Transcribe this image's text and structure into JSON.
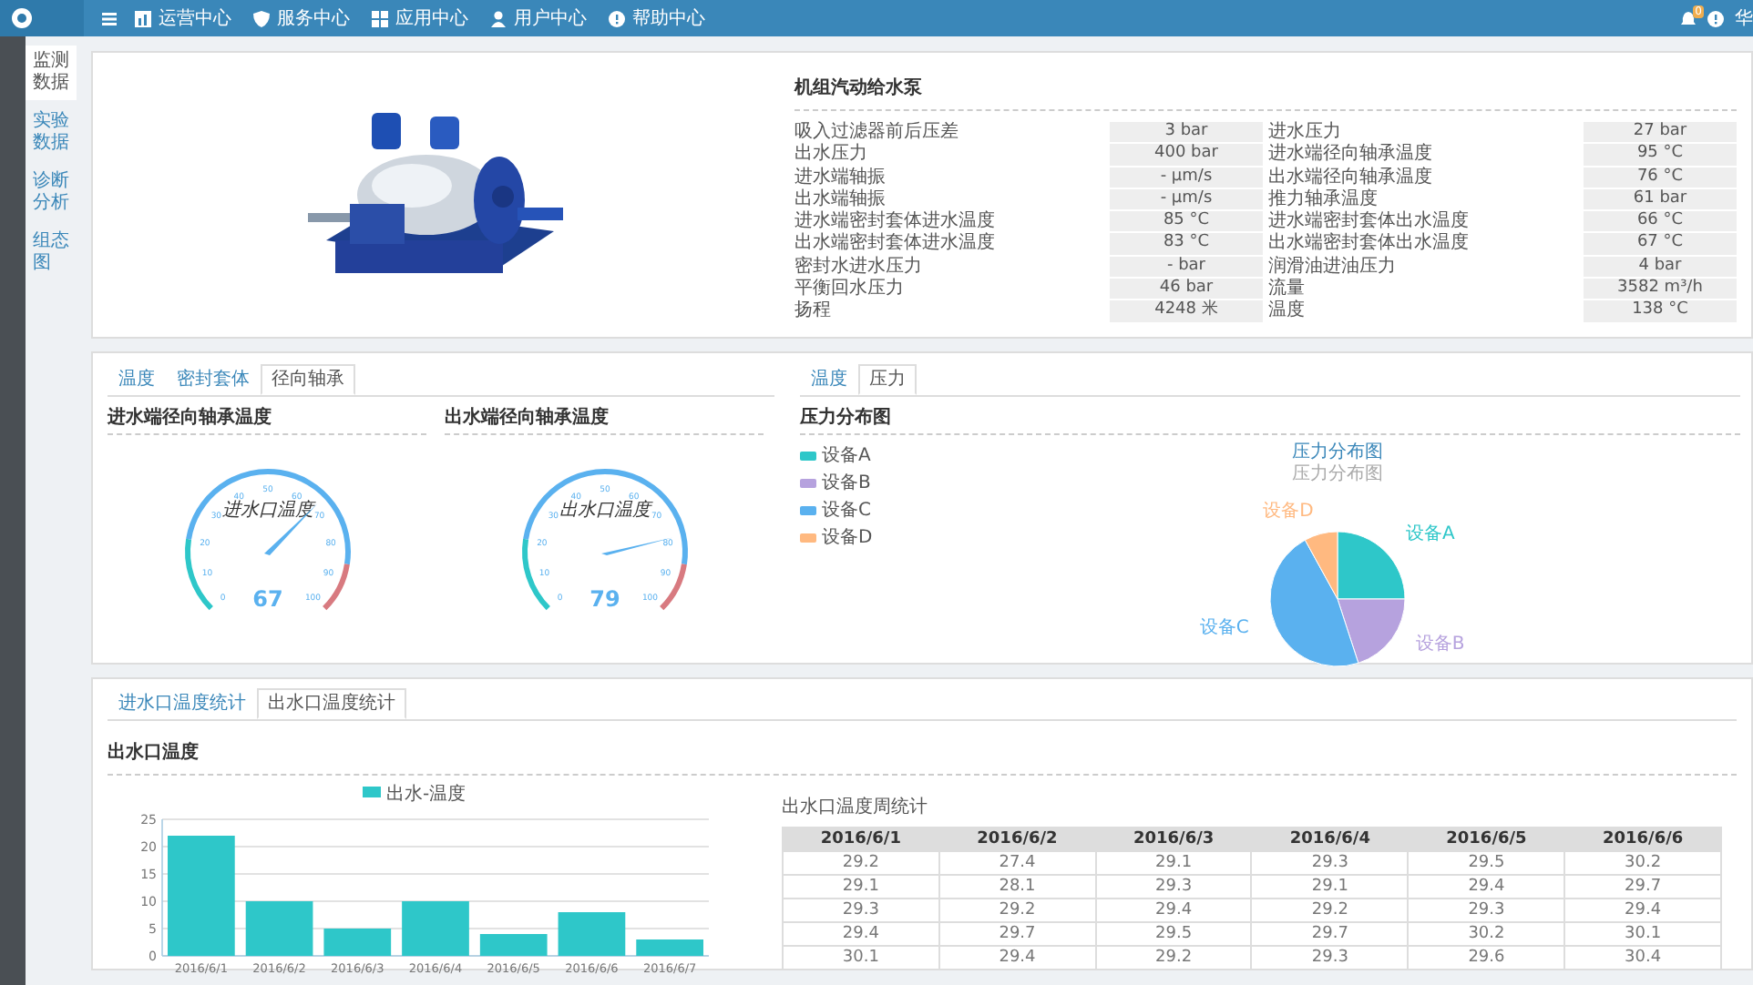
{
  "topbar": {
    "nav": [
      {
        "label": "运营中心"
      },
      {
        "label": "服务中心"
      },
      {
        "label": "应用中心"
      },
      {
        "label": "用户中心"
      },
      {
        "label": "帮助中心"
      }
    ],
    "notification_count": "0",
    "user": "华"
  },
  "sidebar": {
    "items": [
      {
        "label": "监测数据",
        "selected": true
      },
      {
        "label": "实验数据",
        "selected": false
      },
      {
        "label": "诊断分析",
        "selected": false
      },
      {
        "label": "组态图",
        "selected": false
      }
    ]
  },
  "device": {
    "title": "机组汽动给水泵",
    "params": [
      {
        "label": "吸入过滤器前后压差",
        "value": "3 bar"
      },
      {
        "label": "进水压力",
        "value": "27 bar"
      },
      {
        "label": "出水压力",
        "value": "400 bar"
      },
      {
        "label": "进水端径向轴承温度",
        "value": "95 °C"
      },
      {
        "label": "进水端轴振",
        "value": "- μm/s"
      },
      {
        "label": "出水端径向轴承温度",
        "value": "76 °C"
      },
      {
        "label": "出水端轴振",
        "value": "- μm/s"
      },
      {
        "label": "推力轴承温度",
        "value": "61 bar"
      },
      {
        "label": "进水端密封套体进水温度",
        "value": "85 °C"
      },
      {
        "label": "进水端密封套体出水温度",
        "value": "66 °C"
      },
      {
        "label": "出水端密封套体进水温度",
        "value": "83 °C"
      },
      {
        "label": "出水端密封套体出水温度",
        "value": "67 °C"
      },
      {
        "label": "密封水进水压力",
        "value": "- bar"
      },
      {
        "label": "润滑油进油压力",
        "value": "4 bar"
      },
      {
        "label": "平衡回水压力",
        "value": "46 bar"
      },
      {
        "label": "流量",
        "value": "3582 m³/h"
      },
      {
        "label": "扬程",
        "value": "4248 米"
      },
      {
        "label": "温度",
        "value": "138 °C"
      }
    ]
  },
  "bearing_panel": {
    "tabs": [
      {
        "label": "温度",
        "selected": false
      },
      {
        "label": "密封套体",
        "selected": false
      },
      {
        "label": "径向轴承",
        "selected": true
      }
    ],
    "gauges": [
      {
        "title": "进水端径向轴承温度",
        "name": "进水口温度",
        "value": "67",
        "ticks": [
          "0",
          "10",
          "20",
          "30",
          "40",
          "50",
          "60",
          "70",
          "80",
          "90",
          "100"
        ]
      },
      {
        "title": "出水端径向轴承温度",
        "name": "出水口温度",
        "value": "79",
        "ticks": [
          "0",
          "10",
          "20",
          "30",
          "40",
          "50",
          "60",
          "70",
          "80",
          "90",
          "100"
        ]
      }
    ]
  },
  "pressure_panel": {
    "tabs": [
      {
        "label": "温度",
        "selected": false
      },
      {
        "label": "压力",
        "selected": true
      }
    ],
    "heading": "压力分布图",
    "pie_title": "压力分布图",
    "pie_subtitle": "压力分布图",
    "pie_labels": [
      "设备A",
      "设备B",
      "设备C",
      "设备D"
    ],
    "legend": [
      {
        "label": "设备A",
        "color": "#2ec7c9"
      },
      {
        "label": "设备B",
        "color": "#b6a2de"
      },
      {
        "label": "设备C",
        "color": "#5ab1ef"
      },
      {
        "label": "设备D",
        "color": "#ffb980"
      }
    ]
  },
  "stats_panel": {
    "tabs": [
      {
        "label": "进水口温度统计",
        "selected": false
      },
      {
        "label": "出水口温度统计",
        "selected": true
      }
    ],
    "heading": "出水口温度",
    "chart_data": {
      "type": "bar",
      "categories": [
        "2016/6/1",
        "2016/6/2",
        "2016/6/3",
        "2016/6/4",
        "2016/6/5",
        "2016/6/6",
        "2016/6/7"
      ],
      "series": [
        {
          "name": "出水-温度",
          "color": "#2ec7c9",
          "values": [
            22,
            10,
            5,
            10,
            4,
            8,
            3
          ]
        }
      ],
      "ylim": [
        0,
        25
      ],
      "grid": true,
      "yticks": [
        0,
        5,
        10,
        15,
        20,
        25
      ]
    },
    "table": {
      "title": "出水口温度周统计",
      "columns": [
        "2016/6/1",
        "2016/6/2",
        "2016/6/3",
        "2016/6/4",
        "2016/6/5",
        "2016/6/6"
      ],
      "rows": [
        [
          "29.2",
          "27.4",
          "29.1",
          "29.3",
          "29.5",
          "30.2"
        ],
        [
          "29.1",
          "28.1",
          "29.3",
          "29.1",
          "29.4",
          "29.7"
        ],
        [
          "29.3",
          "29.2",
          "29.4",
          "29.2",
          "29.3",
          "29.4"
        ],
        [
          "29.4",
          "29.7",
          "29.5",
          "29.7",
          "30.2",
          "30.1"
        ],
        [
          "30.1",
          "29.4",
          "29.2",
          "29.3",
          "29.6",
          "30.4"
        ]
      ]
    }
  }
}
